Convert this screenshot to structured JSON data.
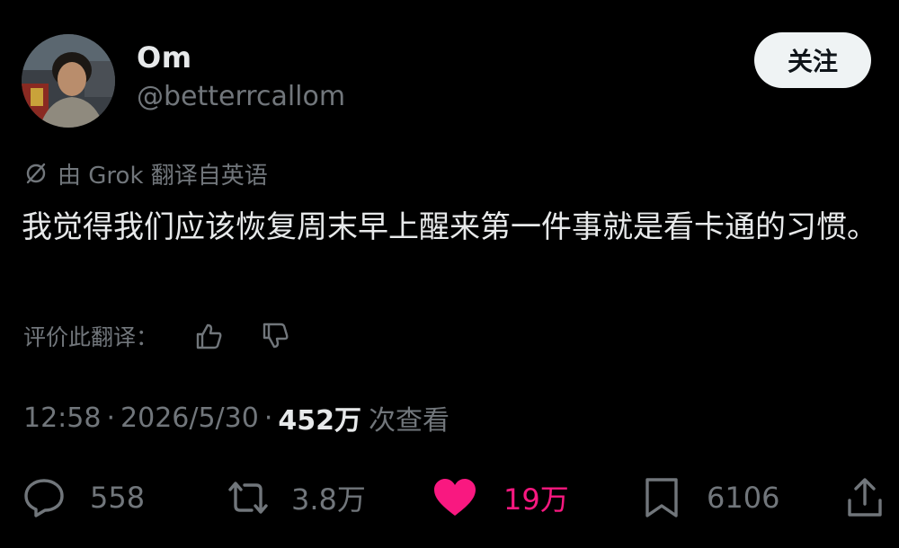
{
  "author": {
    "display_name": "Om",
    "handle": "@betterrcallom"
  },
  "follow_button": {
    "label": "关注"
  },
  "translation": {
    "notice": "由 Grok 翻译自英语",
    "rate_label": "评价此翻译：",
    "icons": [
      "grok-icon",
      "thumbs-up-icon",
      "thumbs-down-icon"
    ]
  },
  "tweet": {
    "text": "我觉得我们应该恢复周末早上醒来第一件事就是看卡通的习惯。"
  },
  "meta": {
    "time": "12:58",
    "separator": "·",
    "date": "2026/5/30",
    "views_count": "452万",
    "views_label": "次查看"
  },
  "actions": {
    "reply": {
      "icon": "reply-icon",
      "count": "558"
    },
    "retweet": {
      "icon": "retweet-icon",
      "count": "3.8万"
    },
    "like": {
      "icon": "heart-icon",
      "count": "19万",
      "liked": true
    },
    "bookmark": {
      "icon": "bookmark-icon",
      "count": "6106"
    },
    "share": {
      "icon": "share-icon"
    }
  },
  "colors": {
    "background": "#000000",
    "primary_text": "#e7e9ea",
    "secondary_text": "#71767b",
    "like_pink": "#f91880",
    "follow_bg": "#eff3f4"
  }
}
